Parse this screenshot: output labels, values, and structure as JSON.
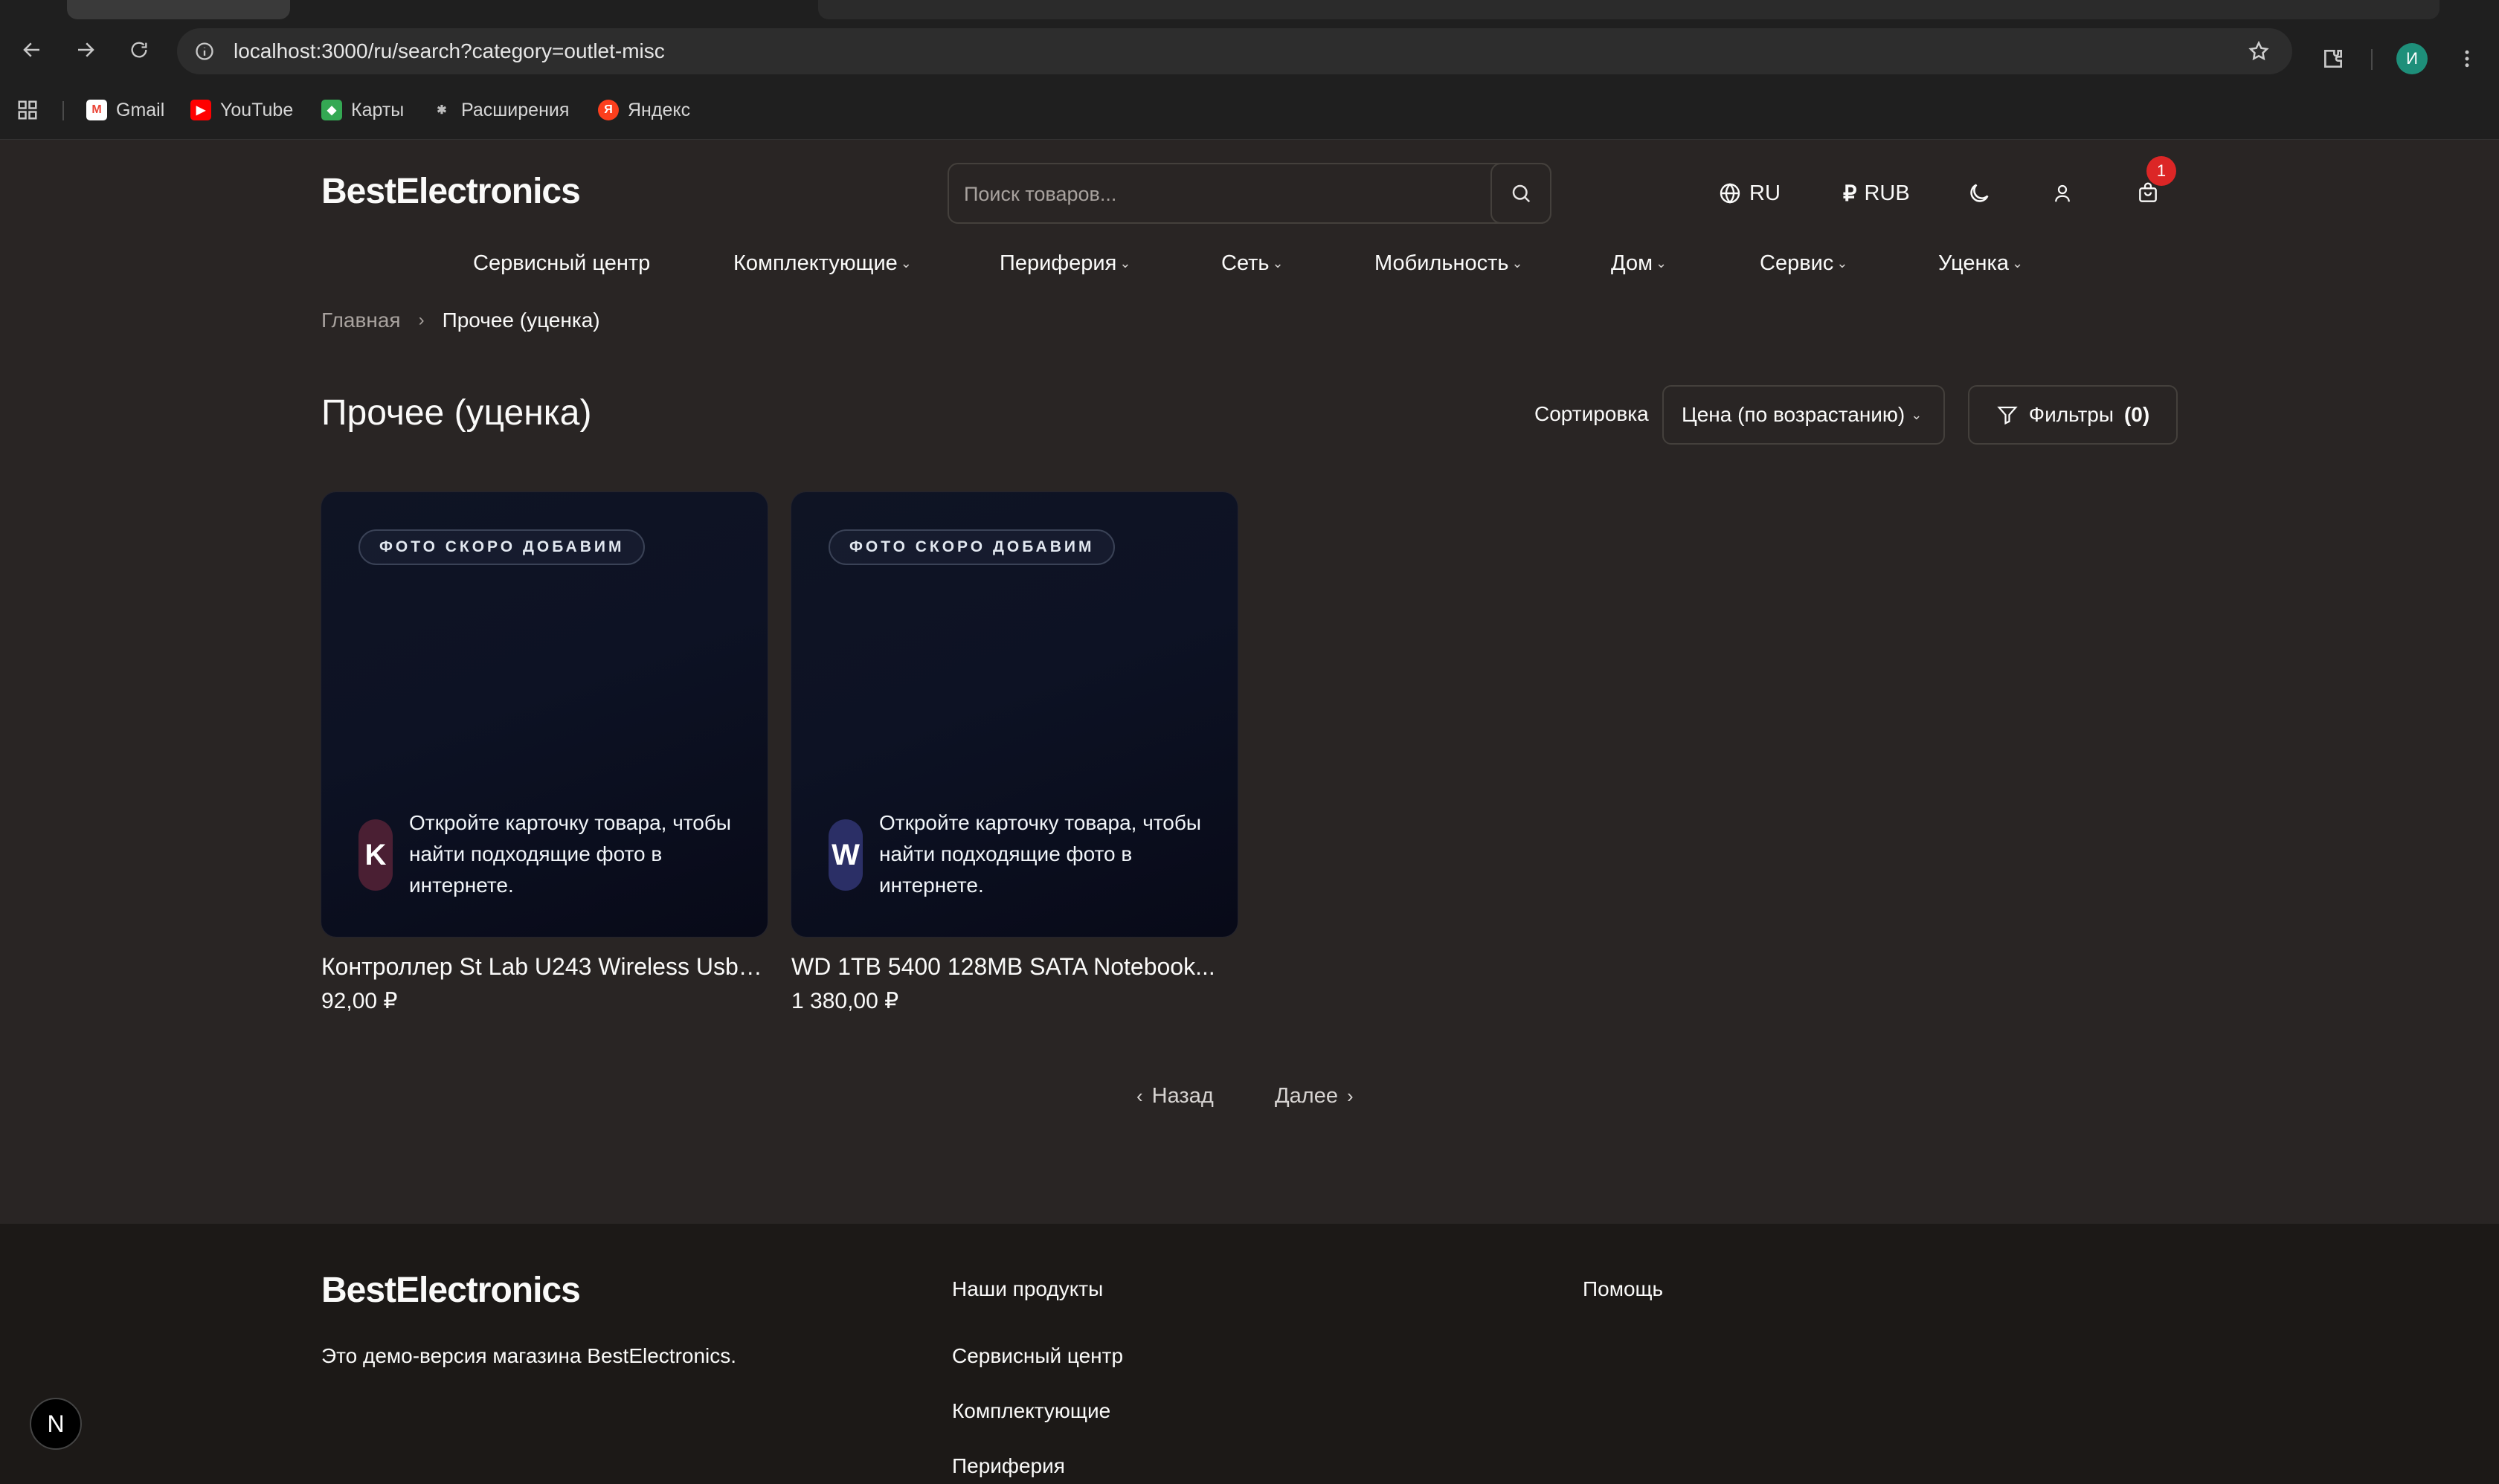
{
  "browser": {
    "url": "localhost:3000/ru/search?category=outlet-misc",
    "profile_initial": "И",
    "bookmarks": [
      {
        "label": "Gmail",
        "icon": "gmail-icon",
        "color": "#ea4335"
      },
      {
        "label": "YouTube",
        "icon": "youtube-icon",
        "color": "#ff0000"
      },
      {
        "label": "Карты",
        "icon": "maps-icon",
        "color": "#34a853"
      },
      {
        "label": "Расширения",
        "icon": "puzzle-icon",
        "color": "#9e9e9e"
      },
      {
        "label": "Яндекс",
        "icon": "yandex-icon",
        "color": "#fc3f1d"
      }
    ]
  },
  "header": {
    "logo": "BestElectronics",
    "search_placeholder": "Поиск товаров...",
    "language": "RU",
    "currency": "RUB",
    "currency_symbol": "₽",
    "cart_count": "1"
  },
  "nav": {
    "items": [
      {
        "label": "Сервисный центр",
        "dropdown": false
      },
      {
        "label": "Комплектующие",
        "dropdown": true
      },
      {
        "label": "Периферия",
        "dropdown": true
      },
      {
        "label": "Сеть",
        "dropdown": true
      },
      {
        "label": "Мобильность",
        "dropdown": true
      },
      {
        "label": "Дом",
        "dropdown": true
      },
      {
        "label": "Сервис",
        "dropdown": true
      },
      {
        "label": "Уценка",
        "dropdown": true
      }
    ]
  },
  "breadcrumb": {
    "home": "Главная",
    "current": "Прочее (уценка)"
  },
  "page": {
    "title": "Прочее (уценка)",
    "sort_label": "Сортировка",
    "sort_value": "Цена (по возрастанию)",
    "filters_label": "Фильтры",
    "filters_count": "(0)"
  },
  "products": [
    {
      "badge": "ФОТО СКОРО ДОБАВИМ",
      "initial": "K",
      "initial_color": "#4a1f33",
      "hint": "Откройте карточку товара, чтобы найти подходящие фото в интернете.",
      "title": "Контроллер St Lab U243 Wireless Usb t...",
      "price": "92,00 ₽"
    },
    {
      "badge": "ФОТО СКОРО ДОБАВИМ",
      "initial": "W",
      "initial_color": "#2b2f66",
      "hint": "Откройте карточку товара, чтобы найти подходящие фото в интернете.",
      "title": "WD 1TB 5400 128MB SATA Notebook...",
      "price": "1 380,00 ₽"
    }
  ],
  "pagination": {
    "prev": "Назад",
    "next": "Далее"
  },
  "footer": {
    "logo": "BestElectronics",
    "description": "Это демо-версия магазина BestElectronics.",
    "products_heading": "Наши продукты",
    "help_heading": "Помощь",
    "links": [
      "Сервисный центр",
      "Комплектующие",
      "Периферия"
    ]
  },
  "dev": {
    "badge": "N"
  }
}
